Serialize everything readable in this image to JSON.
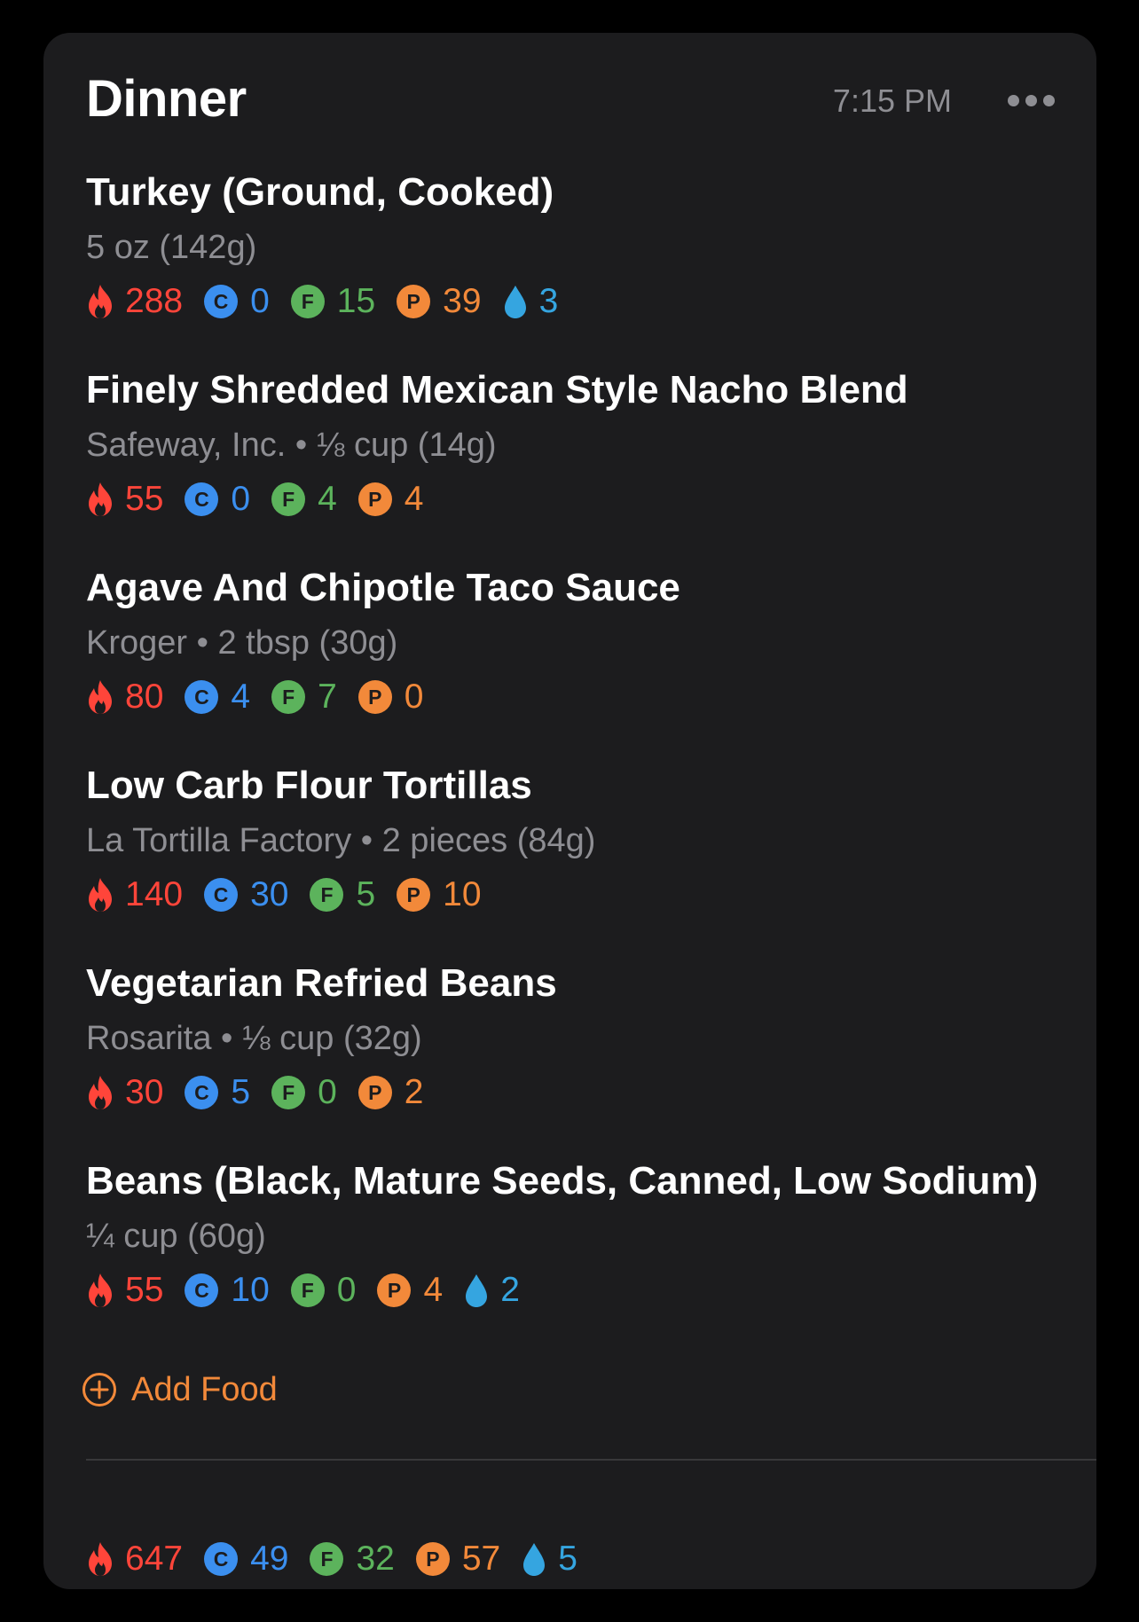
{
  "meal": {
    "title": "Dinner",
    "time": "7:15 PM",
    "more_label": "•••"
  },
  "colors": {
    "calories": "#ff453a",
    "carbs": "#3b8fef",
    "fat": "#5cb35c",
    "protein": "#f2893a",
    "water": "#35a5e0",
    "card": "#1c1c1e"
  },
  "badges": {
    "carbs": "C",
    "fat": "F",
    "protein": "P"
  },
  "items": [
    {
      "name": "Turkey (Ground, Cooked)",
      "detail": "5 oz (142g)",
      "calories": "288",
      "carbs": "0",
      "fat": "15",
      "protein": "39",
      "water": "3"
    },
    {
      "name": "Finely Shredded Mexican Style Nacho Blend",
      "detail": "Safeway, Inc. • ⅛ cup (14g)",
      "calories": "55",
      "carbs": "0",
      "fat": "4",
      "protein": "4",
      "water": null
    },
    {
      "name": "Agave And Chipotle Taco Sauce",
      "detail": "Kroger • 2 tbsp (30g)",
      "calories": "80",
      "carbs": "4",
      "fat": "7",
      "protein": "0",
      "water": null
    },
    {
      "name": "Low Carb Flour Tortillas",
      "detail": "La Tortilla Factory • 2 pieces (84g)",
      "calories": "140",
      "carbs": "30",
      "fat": "5",
      "protein": "10",
      "water": null
    },
    {
      "name": "Vegetarian Refried Beans",
      "detail": "Rosarita • ⅛ cup (32g)",
      "calories": "30",
      "carbs": "5",
      "fat": "0",
      "protein": "2",
      "water": null
    },
    {
      "name": "Beans (Black, Mature Seeds, Canned, Low Sodium)",
      "detail": "¼ cup (60g)",
      "calories": "55",
      "carbs": "10",
      "fat": "0",
      "protein": "4",
      "water": "2"
    }
  ],
  "add_food": {
    "label": "Add Food",
    "icon": "plus-circle-icon"
  },
  "totals": {
    "calories": "647",
    "carbs": "49",
    "fat": "32",
    "protein": "57",
    "water": "5"
  }
}
